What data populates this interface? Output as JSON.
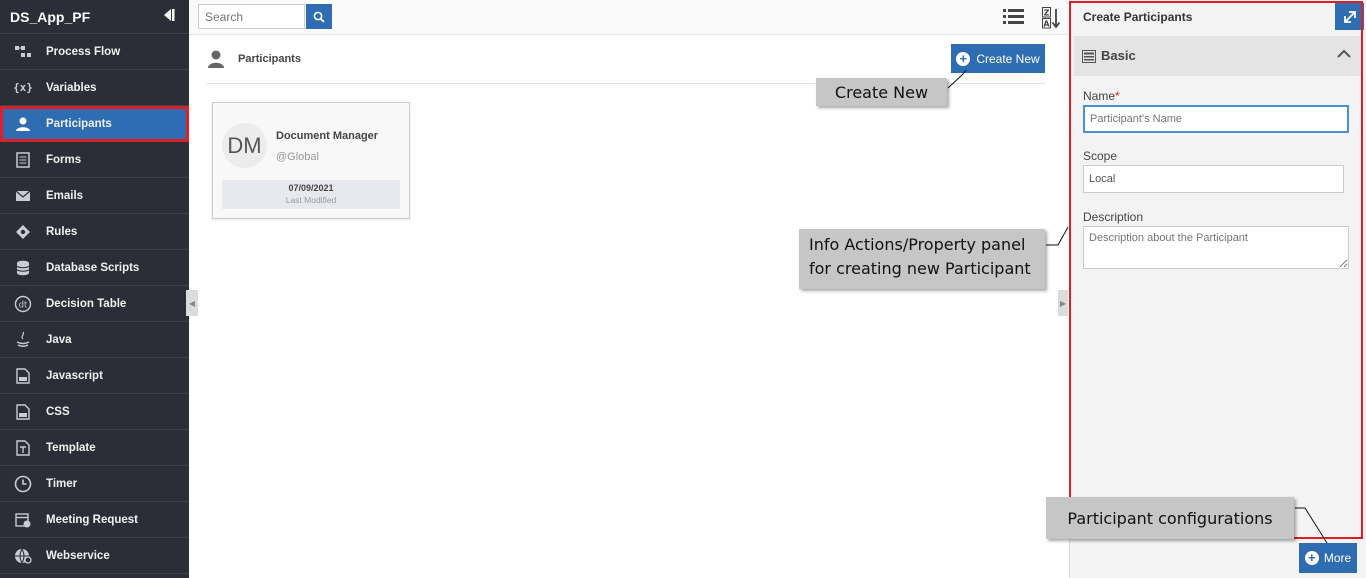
{
  "sidebar": {
    "app_title": "DS_App_PF",
    "items": [
      {
        "label": "Process Flow",
        "icon": "process-flow-icon"
      },
      {
        "label": "Variables",
        "icon": "variables-icon"
      },
      {
        "label": "Participants",
        "icon": "participant-icon",
        "active": true
      },
      {
        "label": "Forms",
        "icon": "forms-icon"
      },
      {
        "label": "Emails",
        "icon": "email-icon"
      },
      {
        "label": "Rules",
        "icon": "rules-icon"
      },
      {
        "label": "Database Scripts",
        "icon": "database-icon"
      },
      {
        "label": "Decision Table",
        "icon": "decision-table-icon"
      },
      {
        "label": "Java",
        "icon": "java-icon"
      },
      {
        "label": "Javascript",
        "icon": "javascript-icon"
      },
      {
        "label": "CSS",
        "icon": "css-icon"
      },
      {
        "label": "Template",
        "icon": "template-icon"
      },
      {
        "label": "Timer",
        "icon": "timer-icon"
      },
      {
        "label": "Meeting Request",
        "icon": "meeting-request-icon"
      },
      {
        "label": "Webservice",
        "icon": "webservice-icon"
      }
    ]
  },
  "toolbar": {
    "search_placeholder": "Search"
  },
  "content": {
    "title": "Participants",
    "create_button": "Create New",
    "cards": [
      {
        "initials": "DM",
        "name": "Document Manager",
        "scope": "@Global",
        "date": "07/09/2021",
        "date_label": "Last Modified"
      }
    ]
  },
  "panel": {
    "title": "Create Participants",
    "section": "Basic",
    "name_label": "Name",
    "name_required": "*",
    "name_placeholder": "Participant's Name",
    "scope_label": "Scope",
    "scope_value": "Local",
    "description_label": "Description",
    "description_placeholder": "Description about the Participant",
    "more_button": "More"
  },
  "callouts": {
    "create_new": "Create New",
    "panel_line1": "Info Actions/Property panel",
    "panel_line2": "for creating new Participant",
    "config": "Participant configurations"
  },
  "colors": {
    "sidebar_bg": "#2b2e36",
    "accent": "#2f6db3",
    "highlight_border": "#e01e26",
    "callout_bg": "#c6c6c6"
  }
}
